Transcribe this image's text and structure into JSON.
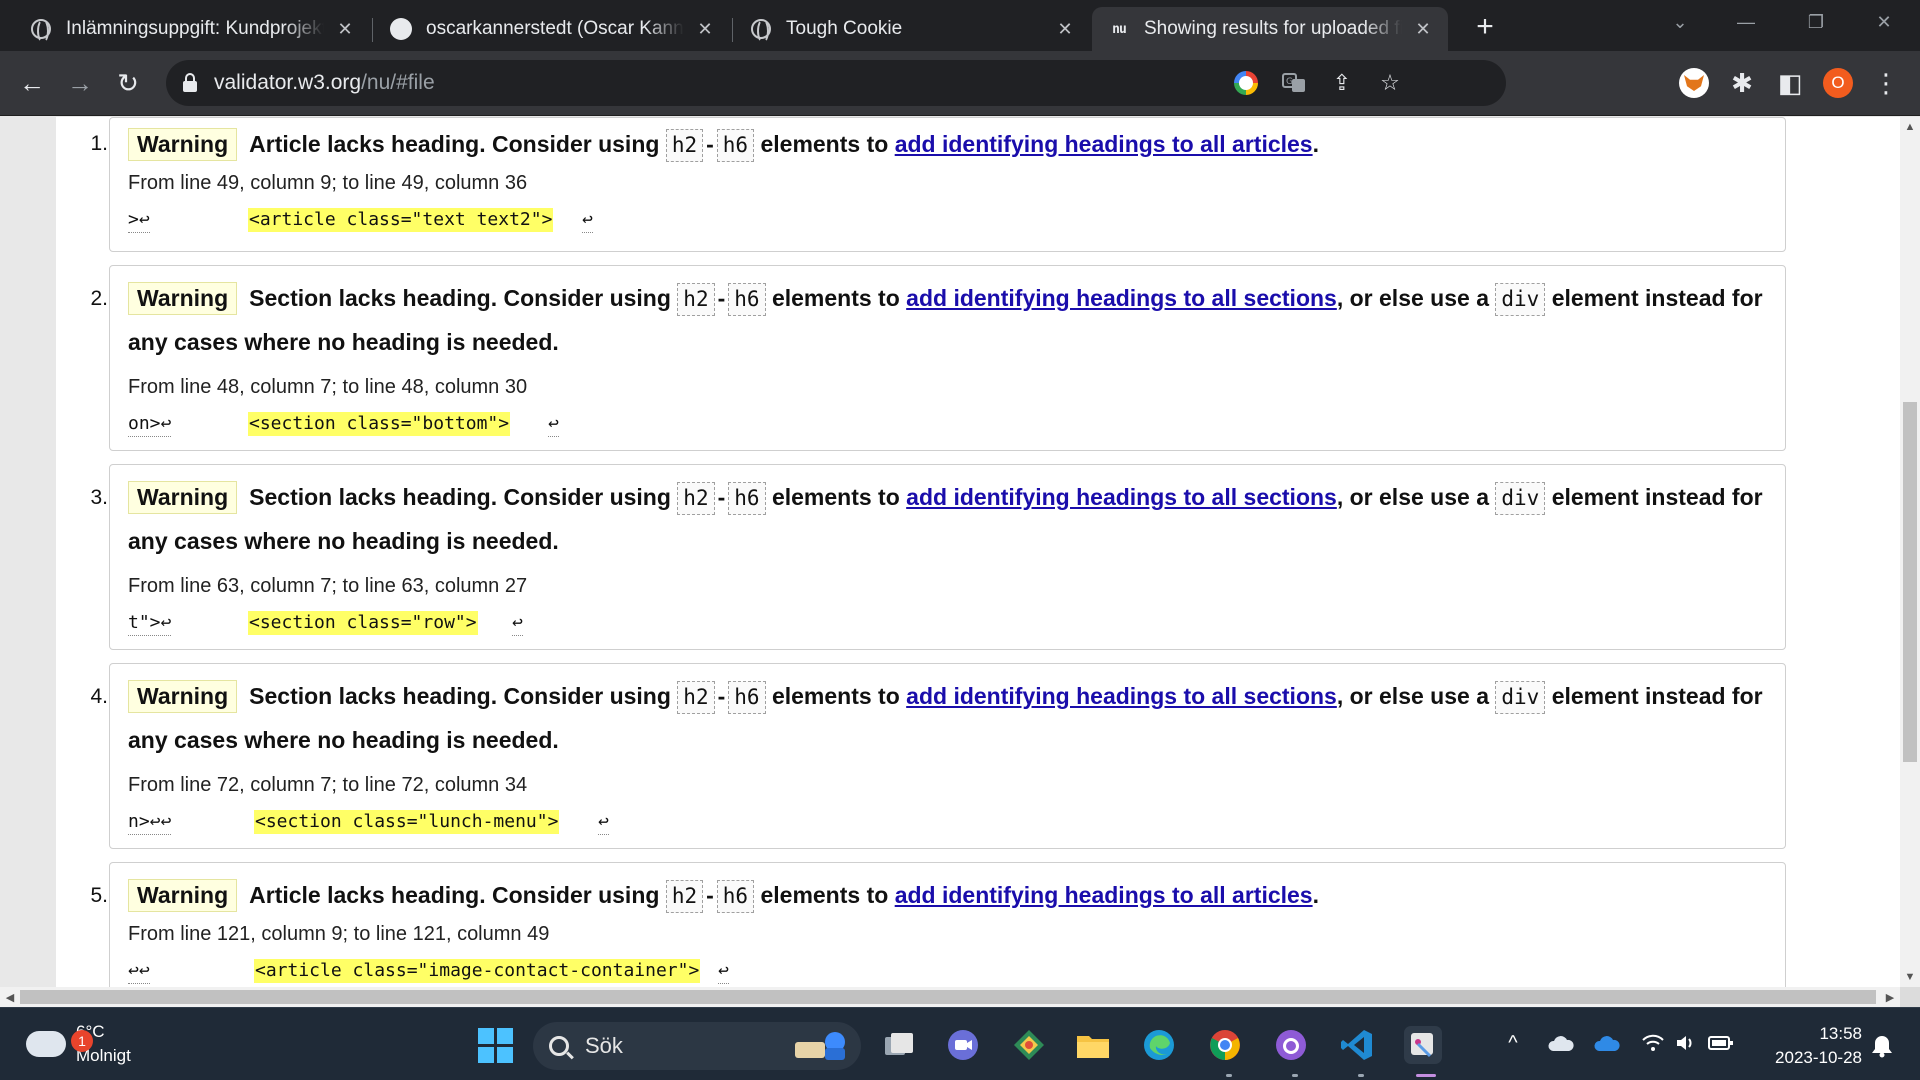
{
  "tabs": [
    {
      "title": "Inlämningsuppgift: Kundprojekt",
      "close": "✕"
    },
    {
      "title": "oscarkannerstedt (Oscar Kannerstedt)",
      "close": "✕"
    },
    {
      "title": "Tough Cookie",
      "close": "✕"
    },
    {
      "title": "Showing results for uploaded file",
      "close": "✕",
      "favicon_text": "nu"
    }
  ],
  "new_tab": "+",
  "window_controls": {
    "tabsearch": "⌄",
    "minimize": "—",
    "restore": "❐",
    "close": "✕"
  },
  "toolbar": {
    "back": "←",
    "forward": "→",
    "reload": "↻",
    "url_host": "validator.w3.org",
    "url_path": "/nu/#file",
    "share": "⇪",
    "bookmark": "☆",
    "extensions": "✱",
    "sidepanel": "◧",
    "profile_initial": "O",
    "menu": "⋮"
  },
  "messages": [
    {
      "number": "1.",
      "type": "Warning",
      "text_before": "Article lacks heading. Consider using",
      "code1": "h2",
      "dash": "-",
      "code2": "h6",
      "text_mid": "elements to",
      "link": "add identifying headings to all articles",
      "text_after": ".",
      "location": "From line 49, column 9; to line 49, column 36",
      "extract_pre": ">↩",
      "extract_hl": "<article class=\"text text2\">",
      "extract_post": "↩"
    },
    {
      "number": "2.",
      "type": "Warning",
      "text_before": "Section lacks heading. Consider using",
      "code1": "h2",
      "dash": "-",
      "code2": "h6",
      "text_mid": "elements to",
      "link": "add identifying headings to all sections",
      "text_after": ", or else use a",
      "code3": "div",
      "text_tail": "element instead for any cases where no heading is needed.",
      "location": "From line 48, column 7; to line 48, column 30",
      "extract_pre": "on>↩",
      "extract_hl": "<section class=\"bottom\">",
      "extract_post": "↩"
    },
    {
      "number": "3.",
      "type": "Warning",
      "text_before": "Section lacks heading. Consider using",
      "code1": "h2",
      "dash": "-",
      "code2": "h6",
      "text_mid": "elements to",
      "link": "add identifying headings to all sections",
      "text_after": ", or else use a",
      "code3": "div",
      "text_tail": "element instead for any cases where no heading is needed.",
      "location": "From line 63, column 7; to line 63, column 27",
      "extract_pre": "t\">↩",
      "extract_hl": "<section class=\"row\">",
      "extract_post": "↩"
    },
    {
      "number": "4.",
      "type": "Warning",
      "text_before": "Section lacks heading. Consider using",
      "code1": "h2",
      "dash": "-",
      "code2": "h6",
      "text_mid": "elements to",
      "link": "add identifying headings to all sections",
      "text_after": ", or else use a",
      "code3": "div",
      "text_tail": "element instead for any cases where no heading is needed.",
      "location": "From line 72, column 7; to line 72, column 34",
      "extract_pre": "n>↩↩",
      "extract_hl": "<section class=\"lunch-menu\">",
      "extract_post": "↩"
    },
    {
      "number": "5.",
      "type": "Warning",
      "text_before": "Article lacks heading. Consider using",
      "code1": "h2",
      "dash": "-",
      "code2": "h6",
      "text_mid": "elements to",
      "link": "add identifying headings to all articles",
      "text_after": ".",
      "location": "From line 121, column 9; to line 121, column 49",
      "extract_pre": "↩↩",
      "extract_hl": "<article class=\"image-contact-container\">",
      "extract_post": "↩"
    }
  ],
  "scrollbars": {
    "up": "▲",
    "down": "▼",
    "left": "◀",
    "right": "▶"
  },
  "taskbar": {
    "weather_temp": "6°C",
    "weather_desc": "Molnigt",
    "weather_badge": "1",
    "search_placeholder": "Sök",
    "clock_time": "13:58",
    "clock_date": "2023-10-28",
    "tray_chevron": "^"
  },
  "colors": {
    "warning_bg": "#ffffe0",
    "highlight": "#ffff66",
    "link": "#1a0dab",
    "accent_windows": "#4cc2ff"
  }
}
